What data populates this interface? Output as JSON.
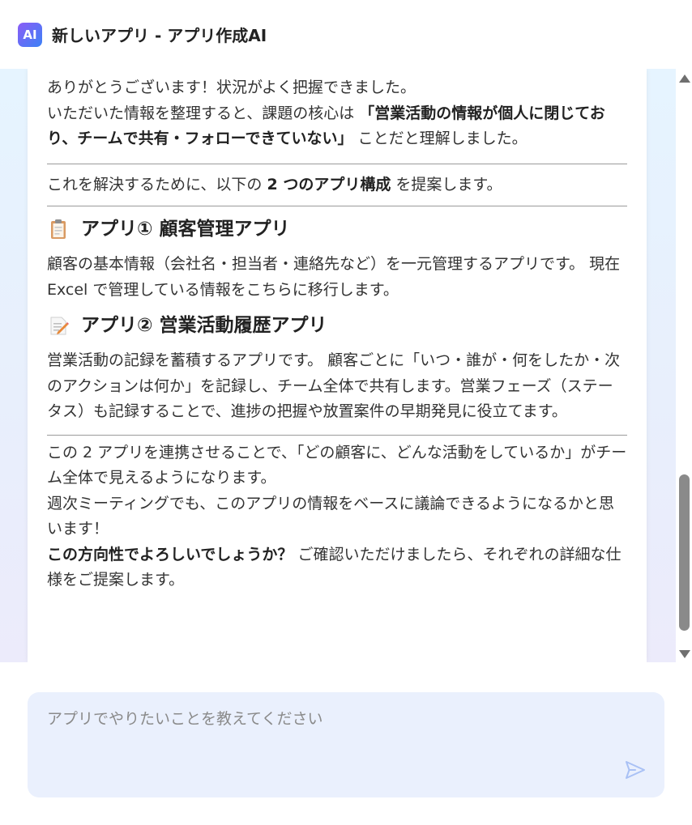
{
  "app": {
    "title": "新しいアプリ - アプリ作成AI",
    "logo_text": "AI",
    "accent_colors": {
      "logo_start": "#8b5cf6",
      "logo_end": "#3b82f6"
    }
  },
  "message": {
    "intro_1": "ありがとうございます！状況がよく把握できました。",
    "intro_2a": "いただいた情報を整理すると、課題の核心は ",
    "intro_2b": "「営業活動の情報が個人に閉じており、チームで共有・フォローできていない」",
    "intro_2c": " ことだと理解しました。",
    "proposal_a": "これを解決するために、以下の ",
    "proposal_b": "2 つのアプリ構成",
    "proposal_c": " を提案します。",
    "app1": {
      "icon": "clipboard-icon",
      "title": "アプリ① 顧客管理アプリ",
      "desc": "顧客の基本情報（会社名・担当者・連絡先など）を一元管理するアプリです。 現在 Excel で管理している情報をこちらに移行します。"
    },
    "app2": {
      "icon": "memo-icon",
      "title": "アプリ② 営業活動履歴アプリ",
      "desc": "営業活動の記録を蓄積するアプリです。 顧客ごとに「いつ・誰が・何をしたか・次のアクションは何か」を記録し、チーム全体で共有します。営業フェーズ（ステータス）も記録することで、進捗の把握や放置案件の早期発見に役立てます。"
    },
    "outro_1": "この 2 アプリを連携させることで、「どの顧客に、どんな活動をしているか」がチーム全体で見えるようになります。",
    "outro_2": "週次ミーティングでも、このアプリの情報をベースに議論できるようになるかと思います！",
    "outro_3a": "この方向性でよろしいでしょうか？",
    "outro_3b": " ご確認いただけましたら、それぞれの詳細な仕様をご提案します。"
  },
  "composer": {
    "placeholder": "アプリでやりたいことを教えてください",
    "send_icon": "send-icon"
  }
}
